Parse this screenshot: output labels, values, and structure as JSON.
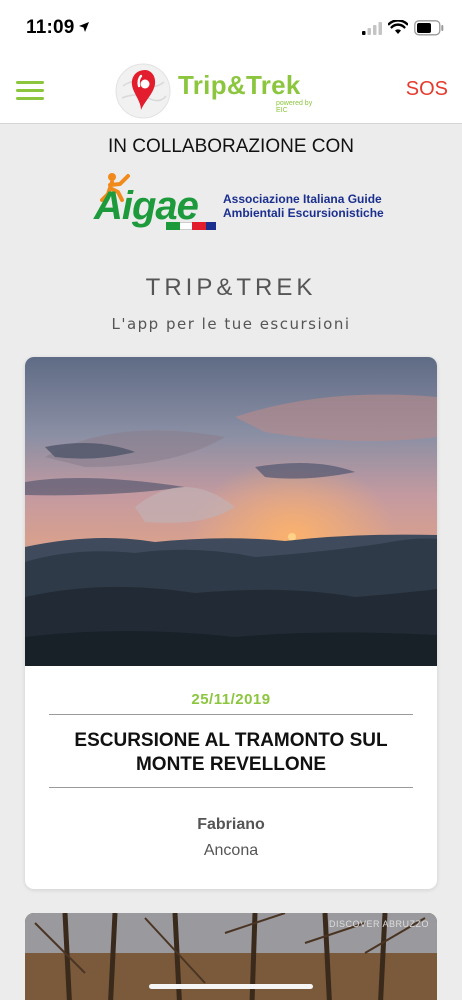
{
  "status_bar": {
    "time": "11:09",
    "icons": [
      "location-arrow-icon",
      "signal-icon",
      "wifi-icon",
      "battery-icon"
    ]
  },
  "navbar": {
    "menu_icon": "hamburger-menu-icon",
    "logo_text": "Trip&Trek",
    "logo_sub": "powered by EIC",
    "sos_label": "SOS",
    "accent_color": "#8cc63f",
    "sos_color": "#e63a2e"
  },
  "partner": {
    "heading": "IN COLLABORAZIONE CON",
    "logo_word": "Aigae",
    "logo_line1": "Associazione Italiana Guide",
    "logo_line2": "Ambientali Escursionistiche"
  },
  "hero": {
    "title": "TRIP&TREK",
    "subtitle": "L'app per le tue escursioni"
  },
  "events": [
    {
      "date": "25/11/2019",
      "title": "ESCURSIONE AL TRAMONTO SUL MONTE REVELLONE",
      "city": "Fabriano",
      "province": "Ancona"
    },
    {
      "watermark": "DISCOVER ABRUZZO"
    }
  ]
}
